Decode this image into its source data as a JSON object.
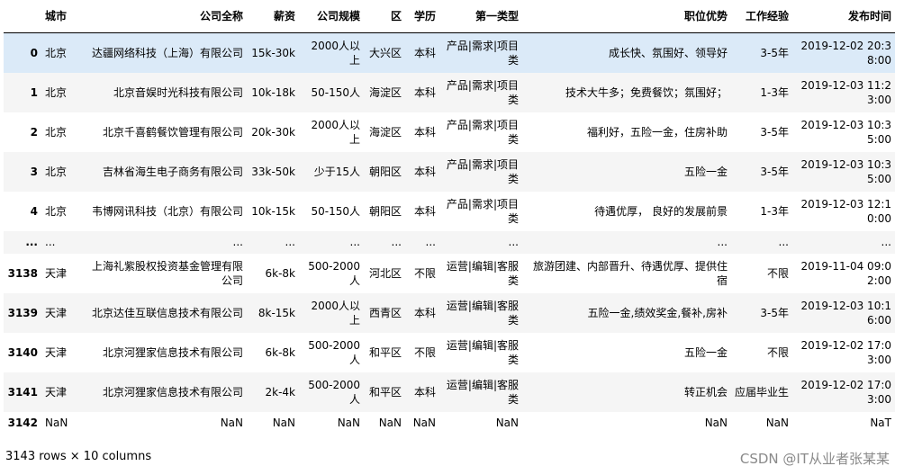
{
  "table": {
    "columns": [
      "",
      "城市",
      "公司全称",
      "薪资",
      "公司规模",
      "区",
      "学历",
      "第一类型",
      "职位优势",
      "工作经验",
      "发布时间"
    ],
    "rows": [
      [
        "0",
        "北京",
        "达疆网络科技（上海）有限公司",
        "15k-30k",
        "2000人以上",
        "大兴区",
        "本科",
        "产品|需求|项目类",
        "成长快、氛围好、领导好",
        "3-5年",
        "2019-12-02 20:38:00"
      ],
      [
        "1",
        "北京",
        "北京音娱时光科技有限公司",
        "10k-18k",
        "50-150人",
        "海淀区",
        "本科",
        "产品|需求|项目类",
        "技术大牛多；免费餐饮；氛围好；",
        "1-3年",
        "2019-12-03 11:23:00"
      ],
      [
        "2",
        "北京",
        "北京千喜鹤餐饮管理有限公司",
        "20k-30k",
        "2000人以上",
        "海淀区",
        "本科",
        "产品|需求|项目类",
        "福利好，五险一金，住房补助",
        "3-5年",
        "2019-12-03 10:35:00"
      ],
      [
        "3",
        "北京",
        "吉林省海生电子商务有限公司",
        "33k-50k",
        "少于15人",
        "朝阳区",
        "本科",
        "产品|需求|项目类",
        "五险一金",
        "3-5年",
        "2019-12-03 10:35:00"
      ],
      [
        "4",
        "北京",
        "韦博网讯科技（北京）有限公司",
        "10k-15k",
        "50-150人",
        "朝阳区",
        "本科",
        "产品|需求|项目类",
        "待遇优厚， 良好的发展前景",
        "1-3年",
        "2019-12-03 12:10:00"
      ],
      [
        "...",
        "...",
        "...",
        "...",
        "...",
        "...",
        "...",
        "...",
        "...",
        "...",
        "..."
      ],
      [
        "3138",
        "天津",
        "上海礼紫股权投资基金管理有限公司",
        "6k-8k",
        "500-2000人",
        "河北区",
        "不限",
        "运营|编辑|客服类",
        "旅游团建、内部晋升、待遇优厚、提供住宿",
        "不限",
        "2019-11-04 09:02:00"
      ],
      [
        "3139",
        "天津",
        "北京达佳互联信息技术有限公司",
        "8k-15k",
        "2000人以上",
        "西青区",
        "本科",
        "运营|编辑|客服类",
        "五险一金,绩效奖金,餐补,房补",
        "3-5年",
        "2019-12-03 10:16:00"
      ],
      [
        "3140",
        "天津",
        "北京河狸家信息技术有限公司",
        "6k-8k",
        "500-2000人",
        "和平区",
        "不限",
        "运营|编辑|客服类",
        "五险一金",
        "不限",
        "2019-12-02 17:03:00"
      ],
      [
        "3141",
        "天津",
        "北京河狸家信息技术有限公司",
        "2k-4k",
        "500-2000人",
        "和平区",
        "本科",
        "运营|编辑|客服类",
        "转正机会",
        "应届毕业生",
        "2019-12-02 17:03:00"
      ],
      [
        "3142",
        "NaN",
        "NaN",
        "NaN",
        "NaN",
        "NaN",
        "NaN",
        "NaN",
        "NaN",
        "NaN",
        "NaT"
      ]
    ]
  },
  "footer": "3143 rows × 10 columns",
  "watermark": "CSDN @IT从业者张某某"
}
